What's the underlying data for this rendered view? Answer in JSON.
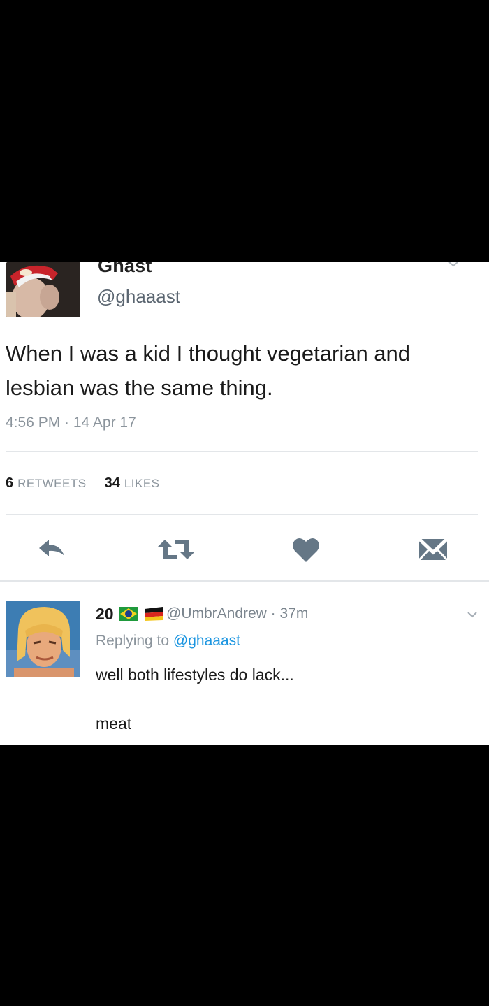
{
  "tweet": {
    "display_name": "Ghast",
    "handle": "@ghaaast",
    "text": "When I was a kid I thought vegetarian and lesbian was the same thing.",
    "timestamp": "4:56 PM · 14 Apr 17",
    "stats": {
      "retweets_count": "6",
      "retweets_label": "RETWEETS",
      "likes_count": "34",
      "likes_label": "LIKES"
    },
    "actions": [
      "reply-icon",
      "retweet-icon",
      "like-heart-icon",
      "direct-message-icon"
    ]
  },
  "reply": {
    "display_name": "20",
    "flags": [
      "brazil-flag-icon",
      "germany-flag-icon"
    ],
    "handle_time": "@UmbrAndrew · 37m",
    "replying_prefix": "Replying to",
    "replying_to": "@ghaaast",
    "text": "well both lifestyles do lack...\n\nmeat"
  },
  "colors": {
    "icon": "#657786",
    "link": "#1b95e0",
    "muted": "#8b949c",
    "background": "#000000",
    "card": "#ffffff"
  }
}
